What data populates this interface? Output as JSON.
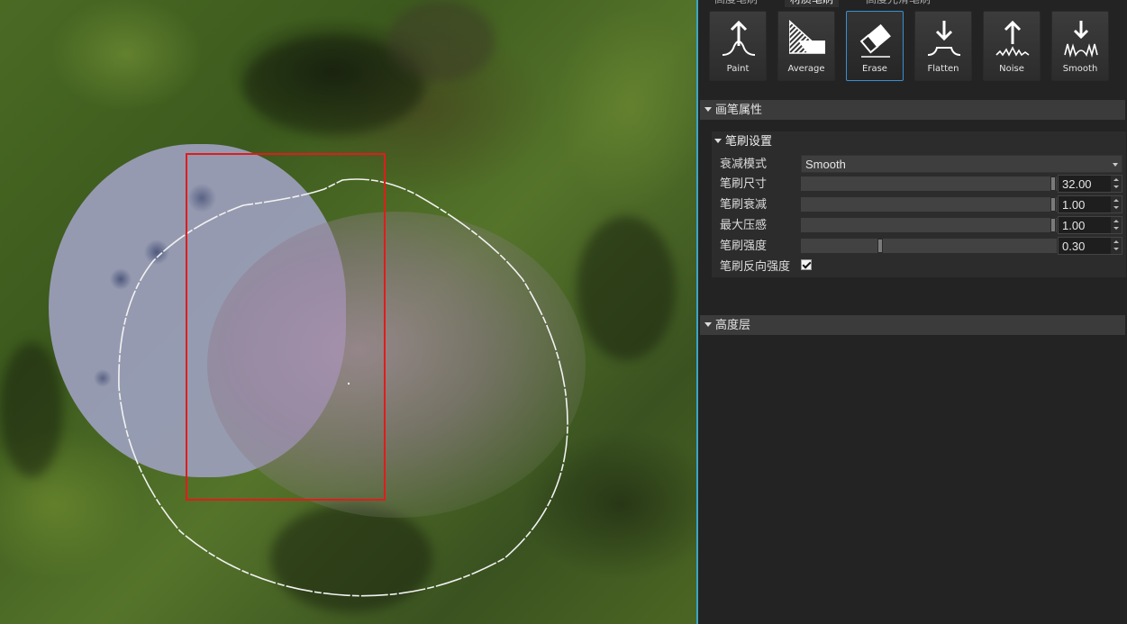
{
  "tabs": [
    "高度笔刷",
    "材质笔刷",
    "高度光滑笔刷"
  ],
  "tools": [
    {
      "label": "Paint",
      "icon": "paint-icon"
    },
    {
      "label": "Average",
      "icon": "average-icon"
    },
    {
      "label": "Erase",
      "icon": "erase-icon"
    },
    {
      "label": "Flatten",
      "icon": "flatten-icon"
    },
    {
      "label": "Noise",
      "icon": "noise-icon"
    },
    {
      "label": "Smooth",
      "icon": "smooth-icon"
    }
  ],
  "selected_tool": "Erase",
  "sections": {
    "brush_props": "画笔属性",
    "brush_settings": "笔刷设置",
    "height_layer": "高度层"
  },
  "settings": {
    "falloff_mode": {
      "label": "衰减模式",
      "value": "Smooth"
    },
    "brush_size": {
      "label": "笔刷尺寸",
      "value": "32.00"
    },
    "brush_falloff": {
      "label": "笔刷衰减",
      "value": "1.00"
    },
    "max_pressure": {
      "label": "最大压感",
      "value": "1.00"
    },
    "brush_strength": {
      "label": "笔刷强度",
      "value": "0.30"
    },
    "brush_invert_strength": {
      "label": "笔刷反向强度",
      "checked": true
    }
  },
  "colors": {
    "selection_rect": "#e01c1c",
    "selected_tool_border": "#3a8fd0",
    "viewport_divider": "#3aa6c7"
  }
}
